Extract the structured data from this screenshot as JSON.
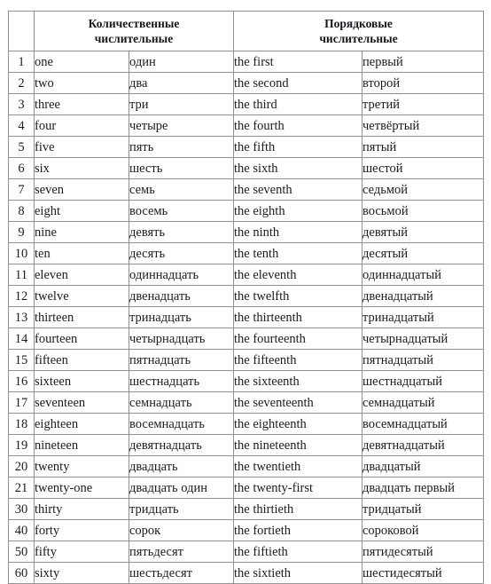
{
  "document": {
    "title": "Числительные",
    "background_color": "#ffffff",
    "text_color": "#1c1c1c",
    "border_color": "#909090"
  },
  "table": {
    "corner_header": "",
    "group_headers": [
      {
        "line1": "Количественные",
        "line2": "числительные",
        "colspan": 2
      },
      {
        "line1": "Порядковые",
        "line2": "числительные",
        "colspan": 2
      }
    ],
    "columns": [
      "number",
      "cardinal_en",
      "cardinal_ru",
      "ordinal_en",
      "ordinal_ru"
    ],
    "rows": [
      {
        "number": "1",
        "cardinal_en": "one",
        "cardinal_ru": "один",
        "ordinal_en": "the first",
        "ordinal_ru": "первый"
      },
      {
        "number": "2",
        "cardinal_en": "two",
        "cardinal_ru": "два",
        "ordinal_en": "the second",
        "ordinal_ru": "второй"
      },
      {
        "number": "3",
        "cardinal_en": "three",
        "cardinal_ru": "три",
        "ordinal_en": "the third",
        "ordinal_ru": "третий"
      },
      {
        "number": "4",
        "cardinal_en": "four",
        "cardinal_ru": "четыре",
        "ordinal_en": "the fourth",
        "ordinal_ru": "четвёртый"
      },
      {
        "number": "5",
        "cardinal_en": "five",
        "cardinal_ru": "пять",
        "ordinal_en": "the fifth",
        "ordinal_ru": "пятый"
      },
      {
        "number": "6",
        "cardinal_en": "six",
        "cardinal_ru": "шесть",
        "ordinal_en": "the sixth",
        "ordinal_ru": "шестой"
      },
      {
        "number": "7",
        "cardinal_en": "seven",
        "cardinal_ru": "семь",
        "ordinal_en": "the seventh",
        "ordinal_ru": "седьмой"
      },
      {
        "number": "8",
        "cardinal_en": "eight",
        "cardinal_ru": "восемь",
        "ordinal_en": "the eighth",
        "ordinal_ru": "восьмой"
      },
      {
        "number": "9",
        "cardinal_en": "nine",
        "cardinal_ru": "девять",
        "ordinal_en": "the ninth",
        "ordinal_ru": "девятый"
      },
      {
        "number": "10",
        "cardinal_en": "ten",
        "cardinal_ru": "десять",
        "ordinal_en": "the tenth",
        "ordinal_ru": "десятый"
      },
      {
        "number": "11",
        "cardinal_en": "eleven",
        "cardinal_ru": "одиннадцать",
        "ordinal_en": "the eleventh",
        "ordinal_ru": "одиннадцатый"
      },
      {
        "number": "12",
        "cardinal_en": "twelve",
        "cardinal_ru": "двенадцать",
        "ordinal_en": "the twelfth",
        "ordinal_ru": "двенадцатый"
      },
      {
        "number": "13",
        "cardinal_en": "thirteen",
        "cardinal_ru": "тринадцать",
        "ordinal_en": "the thirteenth",
        "ordinal_ru": "тринадцатый"
      },
      {
        "number": "14",
        "cardinal_en": "fourteen",
        "cardinal_ru": "четырнадцать",
        "ordinal_en": "the fourteenth",
        "ordinal_ru": "четырнадцатый"
      },
      {
        "number": "15",
        "cardinal_en": "fifteen",
        "cardinal_ru": "пятнадцать",
        "ordinal_en": "the fifteenth",
        "ordinal_ru": "пятнадцатый"
      },
      {
        "number": "16",
        "cardinal_en": "sixteen",
        "cardinal_ru": "шестнадцать",
        "ordinal_en": "the sixteenth",
        "ordinal_ru": "шестнадцатый"
      },
      {
        "number": "17",
        "cardinal_en": "seventeen",
        "cardinal_ru": "семнадцать",
        "ordinal_en": "the seventeenth",
        "ordinal_ru": "семнадцатый"
      },
      {
        "number": "18",
        "cardinal_en": "eighteen",
        "cardinal_ru": "восемнадцать",
        "ordinal_en": "the eighteenth",
        "ordinal_ru": "восемнадцатый"
      },
      {
        "number": "19",
        "cardinal_en": "nineteen",
        "cardinal_ru": "девятнадцать",
        "ordinal_en": "the nineteenth",
        "ordinal_ru": "девятнадцатый"
      },
      {
        "number": "20",
        "cardinal_en": "twenty",
        "cardinal_ru": "двадцать",
        "ordinal_en": "the twentieth",
        "ordinal_ru": "двадцатый"
      },
      {
        "number": "21",
        "cardinal_en": "twenty-one",
        "cardinal_ru": "двадцать один",
        "ordinal_en": "the twenty-first",
        "ordinal_ru": "двадцать первый"
      },
      {
        "number": "30",
        "cardinal_en": "thirty",
        "cardinal_ru": "тридцать",
        "ordinal_en": "the thirtieth",
        "ordinal_ru": "тридцатый"
      },
      {
        "number": "40",
        "cardinal_en": "forty",
        "cardinal_ru": "сорок",
        "ordinal_en": "the fortieth",
        "ordinal_ru": "сороковой"
      },
      {
        "number": "50",
        "cardinal_en": "fifty",
        "cardinal_ru": "пятьдесят",
        "ordinal_en": "the fiftieth",
        "ordinal_ru": "пятидесятый"
      },
      {
        "number": "60",
        "cardinal_en": "sixty",
        "cardinal_ru": "шестьдесят",
        "ordinal_en": "the sixtieth",
        "ordinal_ru": "шестидесятый"
      }
    ]
  }
}
